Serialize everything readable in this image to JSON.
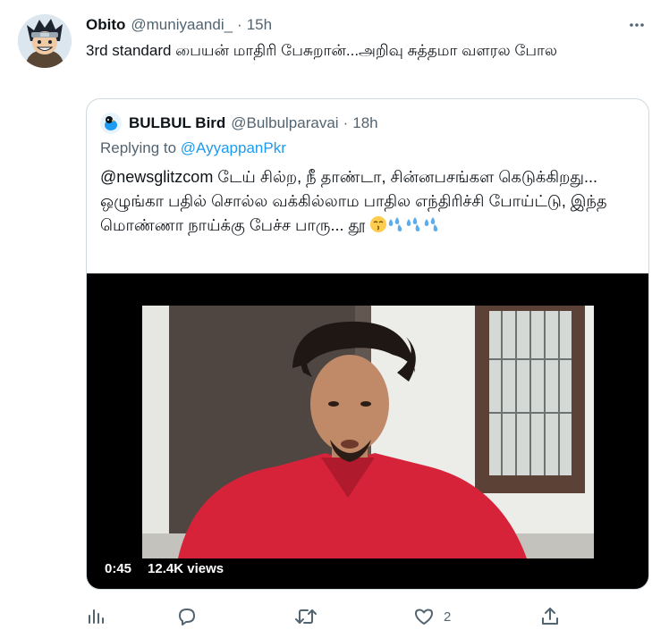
{
  "tweet": {
    "display_name": "Obito",
    "handle": "@muniyaandi_",
    "separator": "·",
    "time": "15h",
    "text": "3rd standard பையன் மாதிரி பேசுறான்...அறிவு சுத்தமா வளரல போல",
    "avatar": "avatar-obito"
  },
  "quoted": {
    "display_name": "BULBUL Bird",
    "handle": "@Bulbulparavai",
    "separator": "·",
    "time": "18h",
    "replying_prefix": "Replying to",
    "replying_to": "@AyyappanPkr",
    "text": "@newsglitzcom டேய் சில்ற, நீ தாண்டா, சின்னபசங்கள கெடுக்கிறது... ஒழுங்கா பதில் சொல்ல வக்கில்லாம பாதில எந்திரிச்சி போய்ட்டு, இந்த மொண்ணா நாய்க்கு பேச்ச பாரு... தூ",
    "emojis": [
      "kissing-face-icon",
      "sweat-droplets-icon",
      "sweat-droplets-icon",
      "sweat-droplets-icon"
    ],
    "video": {
      "duration": "0:45",
      "views": "12.4K views"
    }
  },
  "actions": {
    "analytics": {
      "icon": "analytics-icon"
    },
    "reply": {
      "icon": "reply-icon"
    },
    "retweet": {
      "icon": "retweet-icon"
    },
    "like": {
      "icon": "heart-icon",
      "count": "2"
    },
    "share": {
      "icon": "share-icon"
    }
  },
  "colors": {
    "text": "#0f1419",
    "secondary": "#536471",
    "accent": "#1d9bf0",
    "border": "#cfd9de"
  }
}
